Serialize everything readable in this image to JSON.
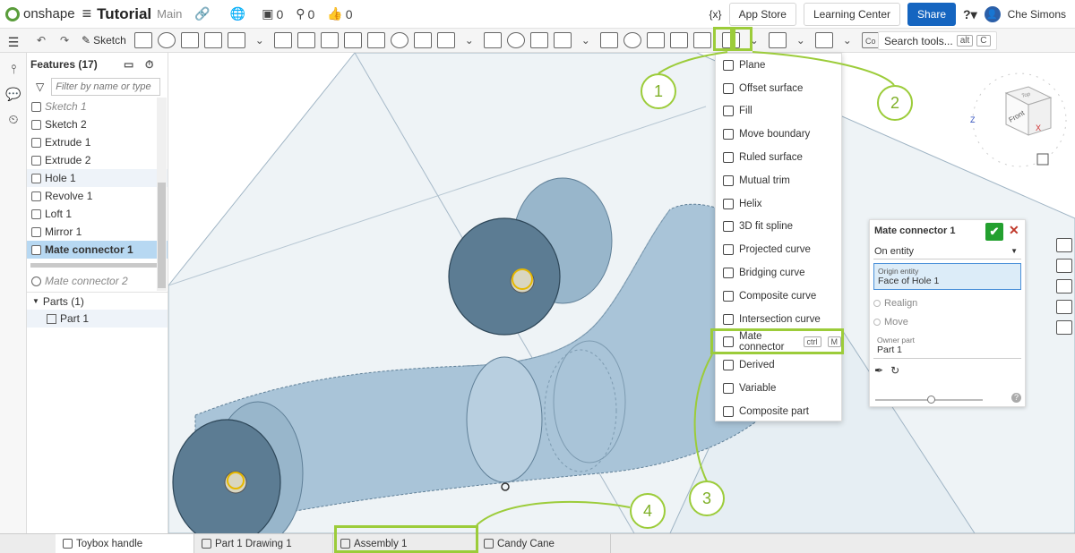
{
  "topbar": {
    "brand": "onshape",
    "doc_title": "Tutorial",
    "branch": "Main",
    "count_versions": "0",
    "count_pins": "0",
    "count_likes": "0",
    "variable_icon": "{x}",
    "app_store": "App Store",
    "learning_center": "Learning Center",
    "share": "Share",
    "help": "?",
    "user_name": "Che Simons"
  },
  "toolbar": {
    "sketch_label": "Sketch",
    "search_placeholder": "Search tools...",
    "search_kbd1": "alt",
    "search_kbd2": "C",
    "co_label": "Co"
  },
  "features": {
    "header": "Features (17)",
    "filter_placeholder": "Filter by name or type",
    "items": [
      {
        "label": "Sketch 1",
        "state": "faded"
      },
      {
        "label": "Sketch 2",
        "state": "normal"
      },
      {
        "label": "Extrude 1",
        "state": "normal"
      },
      {
        "label": "Extrude 2",
        "state": "normal"
      },
      {
        "label": "Hole 1",
        "state": "hover"
      },
      {
        "label": "Revolve 1",
        "state": "normal"
      },
      {
        "label": "Loft 1",
        "state": "normal"
      },
      {
        "label": "Mirror 1",
        "state": "normal"
      },
      {
        "label": "Mate connector 1",
        "state": "selected"
      }
    ],
    "rolled_item": "Mate connector 2",
    "parts_header": "Parts (1)",
    "part": "Part 1"
  },
  "menu": {
    "items": [
      "Plane",
      "Offset surface",
      "Fill",
      "Move boundary",
      "Ruled surface",
      "Mutual trim",
      "Helix",
      "3D fit spline",
      "Projected curve",
      "Bridging curve",
      "Composite curve",
      "Intersection curve",
      "Mate connector",
      "Derived",
      "Variable",
      "Composite part"
    ],
    "mate_kbd1": "ctrl",
    "mate_kbd2": "M"
  },
  "dialog": {
    "title": "Mate connector 1",
    "type_value": "On entity",
    "origin_label": "Origin entity",
    "origin_value": "Face of Hole 1",
    "realign": "Realign",
    "move": "Move",
    "owner_label": "Owner part",
    "owner_value": "Part 1",
    "help": "?"
  },
  "viewcube": {
    "front": "Front",
    "top": "Top",
    "axis_x": "X",
    "axis_z": "Z"
  },
  "tabs": [
    "Toybox handle",
    "Part 1 Drawing 1",
    "Assembly 1",
    "Candy Cane"
  ],
  "callouts": [
    "1",
    "2",
    "3",
    "4"
  ],
  "colors": {
    "accent_green": "#9ccc3a",
    "brand_blue": "#1565c0",
    "ok_green": "#23a02f",
    "selection_blue": "#b7d8f2",
    "part_fill": "#a9c4d8"
  }
}
